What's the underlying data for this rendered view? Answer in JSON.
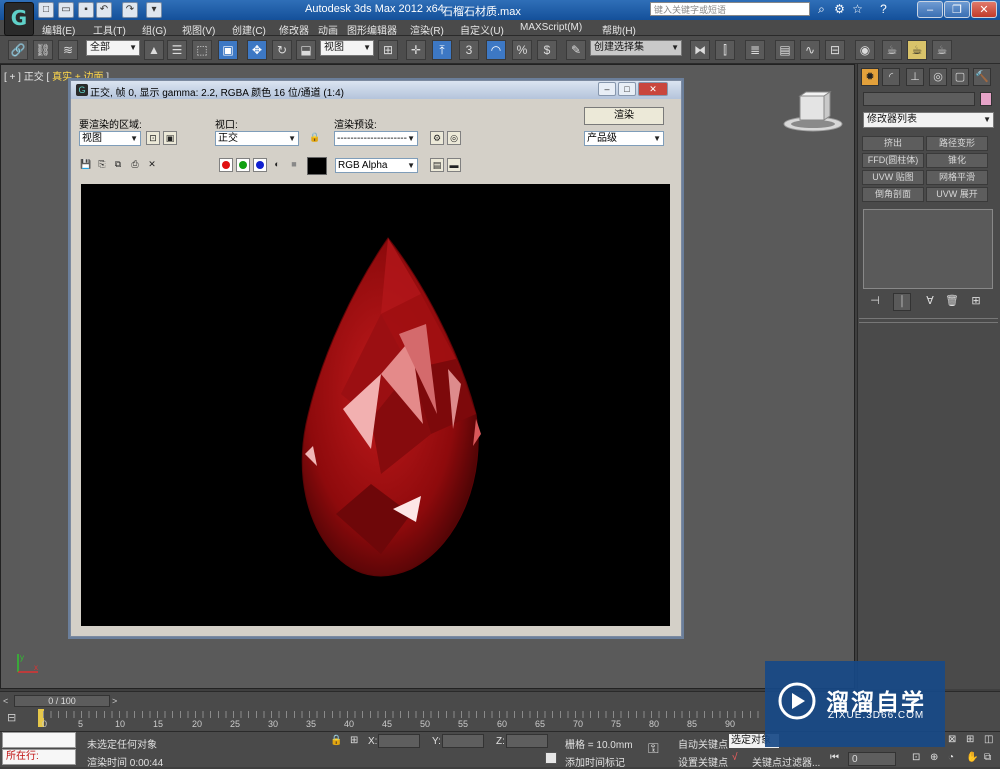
{
  "titlebar": {
    "app_title": "Autodesk 3ds Max  2012 x64",
    "file_name": "石榴石材质.max",
    "search_placeholder": "键入关键字或短语"
  },
  "menu": [
    "编辑(E)",
    "工具(T)",
    "组(G)",
    "视图(V)",
    "创建(C)",
    "修改器",
    "动画",
    "图形编辑器",
    "渲染(R)",
    "自定义(U)",
    "MAXScript(M)",
    "帮助(H)"
  ],
  "toolbar": {
    "selection_filter": "全部",
    "reference_coord": "视图",
    "snap_label": "3",
    "named_selection": "创建选择集"
  },
  "viewport": {
    "label_prefix": "[ + ] 正交 [",
    "label_shading": "真实",
    "label_sep": "+",
    "label_edges": "边面",
    "label_suffix": "]"
  },
  "render_window": {
    "title": "正交, 帧 0, 显示 gamma: 2.2, RGBA 颜色 16 位/通道 (1:4)",
    "area_label": "要渲染的区域:",
    "area_value": "视图",
    "viewport_label": "视口:",
    "viewport_value": "正交",
    "preset_label": "渲染预设:",
    "preset_value": "---------------------",
    "render_button": "渲染",
    "quality_value": "产品级",
    "channel_value": "RGB Alpha"
  },
  "command_panel": {
    "modifier_list": "修改器列表",
    "modifiers": [
      "挤出",
      "路径变形",
      "FFD(圆柱体)",
      "锥化",
      "UVW 贴图",
      "网格平滑",
      "倒角剖面",
      "UVW 展开"
    ]
  },
  "timeline": {
    "slider": "0 / 100",
    "ticks": [
      "0",
      "5",
      "10",
      "15",
      "20",
      "25",
      "30",
      "35",
      "40",
      "45",
      "50",
      "55",
      "60",
      "65",
      "70",
      "75",
      "80",
      "85",
      "90"
    ]
  },
  "status": {
    "running": "所在行:",
    "selection": "未选定任何对象",
    "render_time": "渲染时间  0:00:44",
    "x_label": "X:",
    "y_label": "Y:",
    "z_label": "Z:",
    "grid": "栅格 = 10.0mm",
    "add_time_tag": "添加时间标记",
    "auto_key": "自动关键点",
    "selected_object": "选定对象",
    "set_key": "设置关键点",
    "key_filters": "关键点过滤器...",
    "frame": "0"
  },
  "watermark": {
    "brand": "溜溜自学",
    "url": "ZIXUE.3D66.COM"
  },
  "colors": {
    "title_blue": "#1f5fac",
    "gem_red": "#a40d10",
    "viewport_gray": "#5a5a5a",
    "auto_key_red": "#c01010"
  }
}
